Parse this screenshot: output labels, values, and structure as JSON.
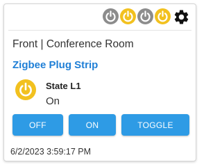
{
  "toolbar": {
    "icons": [
      {
        "icon": "power-icon",
        "state": "off",
        "color": "#8c8c8c"
      },
      {
        "icon": "power-icon",
        "state": "on",
        "color": "#f2c11f"
      },
      {
        "icon": "power-icon",
        "state": "off",
        "color": "#8c8c8c"
      },
      {
        "icon": "power-icon",
        "state": "on",
        "color": "#f2c11f"
      },
      {
        "icon": "gear-icon",
        "color": "#111111"
      }
    ]
  },
  "card": {
    "location": "Front | Conference Room",
    "device_name": "Zigbee Plug Strip",
    "state_icon": "power-icon",
    "state_label": "State L1",
    "state_value": "On",
    "buttons": {
      "off": "OFF",
      "on": "ON",
      "toggle": "TOGGLE"
    },
    "timestamp": "6/2/2023 3:59:17 PM"
  },
  "colors": {
    "accent_blue": "#2e9be5",
    "title_blue": "#1f7fd6",
    "on_yellow": "#f2c11f",
    "off_gray": "#8c8c8c"
  }
}
